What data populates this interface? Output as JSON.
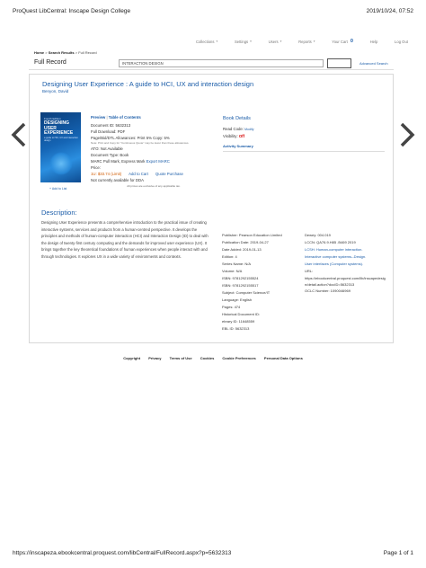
{
  "print": {
    "header_title": "ProQuest LibCentral: Inscape Design College",
    "header_datetime": "2019/10/24, 07:52",
    "footer_url": "https://inscapeza.ebookcentral.proquest.com/libCentral/FullRecord.aspx?p=5632313",
    "footer_page": "Page 1 of 1"
  },
  "nav": {
    "collections": "Collections",
    "settings": "Settings",
    "users": "Users",
    "reports": "Reports",
    "cart": "Your Cart",
    "cart_count": "0",
    "help": "Help",
    "logout": "Log Out"
  },
  "breadcrumb": {
    "home": "Home",
    "search_results": "Search Results",
    "current": "Full Record"
  },
  "titlebar": {
    "page_title": "Full Record",
    "search_value": "INTERACTION DESIGN",
    "advanced": "Advanced Search"
  },
  "book": {
    "title": "Designing User Experience : A guide to HCI, UX and interaction design",
    "author": "Benyon, David",
    "add_to_list": "Add to List",
    "cover": {
      "edition": "Fourth Edition",
      "title": "DESIGNING USER EXPERIENCE",
      "subtitle": "a guide to HCI, UX and interaction design"
    }
  },
  "actions": {
    "preview": "Preview",
    "sep": "|",
    "toc": "Table of Contents",
    "doc_id": "Document ID: 5632313",
    "full_download": "Full Download: PDF",
    "page_allowances": "Page/Bid/DTL Allowances: Print 5% Copy: 5%",
    "note": "Note: Print and Copy for \"Continuous Quote\" may be lower than these allowances.",
    "ato": "ATO: Not Available",
    "doc_type": "Document Type: Book",
    "marc": "MARC Pull Mark, Express Mark",
    "export_marc": "Export MARC",
    "price_label": "Price:",
    "price": "1U: $33.74 (Limit)",
    "add_to_cart": "Add to Cart",
    "quote": "Quote Purchase",
    "dda": "Not currently available for DDA",
    "tax_note": "All prices are exclusive of any applicable tax."
  },
  "details": {
    "title": "Book Details",
    "read_code_label": "Read Code:",
    "read_code_value": "Modify",
    "visibility_label": "Visibility:",
    "visibility_value": "Off",
    "summary_title": "Activity Summary"
  },
  "summary": {
    "left": [
      "Publisher: Pearson Education Limited",
      "Publication Date: 2019-04-27",
      "Date Added: 2019-01-13",
      "Edition: 4",
      "Series Name: N/A",
      "Volume: N/A",
      "ISBN: 9781292155524",
      "ISBN: 9781292155517",
      "Subject: Computer Science/IT",
      "Language: English",
      "Pages: 474",
      "Historical Document ID:",
      "ebrary ID: 11648559",
      "EBL ID: 5632313"
    ],
    "right": [
      "Dewey: 004.019",
      "LCCN: QA76.9.H85 .B469 2019",
      "LCSH: Human-computer interaction.",
      "Interactive computer systems--Design.",
      "User interfaces (Computer systems).",
      "URL:",
      "https://ebookcentral.proquest.com/lib/inscapedesign/detail.action?docID=5632313",
      "OCLC Number: 1090046969"
    ]
  },
  "description": {
    "title": "Description:",
    "text": "Designing User Experience presents a comprehensive introduction to the practical issue of creating interactive systems, services and products from a human-centred perspective. It develops the principles and methods of human-computer interaction (HCI) and Interaction Design (ID) to deal with the design of twenty-first century computing and the demands for improved user experience (UX). It brings together the key theoretical foundations of human experiences when people interact with and through technologies. It explores UX in a wide variety of environments and contexts."
  },
  "footer": {
    "copyright": "Copyright",
    "privacy": "Privacy",
    "terms": "Terms of Use",
    "cookies": "Cookies",
    "cookie_prefs": "Cookie Preferences",
    "personal_data": "Personal Data Options"
  },
  "colors": {
    "link": "#1a5ca8",
    "alert": "#d60000",
    "price": "#d05a00"
  }
}
